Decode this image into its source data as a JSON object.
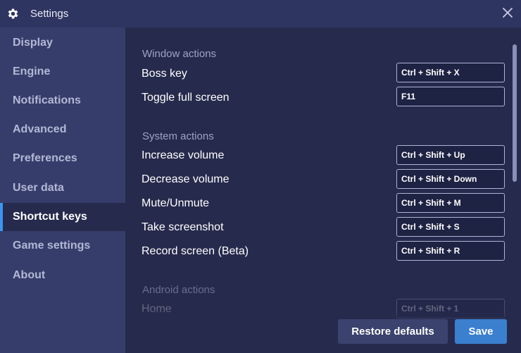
{
  "window": {
    "title": "Settings",
    "icons": {
      "title": "gear-icon",
      "close": "close-icon"
    }
  },
  "sidebar": {
    "items": [
      {
        "label": "Display"
      },
      {
        "label": "Engine"
      },
      {
        "label": "Notifications"
      },
      {
        "label": "Advanced"
      },
      {
        "label": "Preferences"
      },
      {
        "label": "User data"
      },
      {
        "label": "Shortcut keys",
        "active": true
      },
      {
        "label": "Game settings"
      },
      {
        "label": "About"
      }
    ]
  },
  "main": {
    "sections": [
      {
        "title": "Window actions",
        "rows": [
          {
            "label": "Boss key",
            "shortcut": "Ctrl + Shift + X"
          },
          {
            "label": "Toggle full screen",
            "shortcut": "F11"
          }
        ]
      },
      {
        "title": "System actions",
        "rows": [
          {
            "label": "Increase volume",
            "shortcut": "Ctrl + Shift + Up"
          },
          {
            "label": "Decrease volume",
            "shortcut": "Ctrl + Shift + Down"
          },
          {
            "label": "Mute/Unmute",
            "shortcut": "Ctrl + Shift + M"
          },
          {
            "label": "Take screenshot",
            "shortcut": "Ctrl + Shift + S"
          },
          {
            "label": "Record screen (Beta)",
            "shortcut": "Ctrl + Shift + R"
          }
        ]
      },
      {
        "title": "Android actions",
        "rows": [
          {
            "label": "Home",
            "shortcut": "Ctrl + Shift + 1"
          }
        ]
      }
    ]
  },
  "footer": {
    "restore_label": "Restore defaults",
    "save_label": "Save"
  },
  "colors": {
    "background": "#262b4d",
    "sidebar": "#363d6a",
    "accent": "#3b94f2",
    "save_button": "#3b7fcf"
  }
}
